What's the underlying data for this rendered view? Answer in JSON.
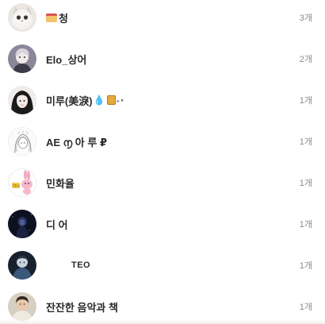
{
  "conversations": [
    {
      "name": "청",
      "count": "3개",
      "avatar_icon": "cat-avatar-icon",
      "prefix_emoji": "cake-icon"
    },
    {
      "name": "Elo_상어",
      "count": "2개",
      "avatar_icon": "anime-character-avatar-icon"
    },
    {
      "name": "미루(美淚)",
      "count": "1개",
      "avatar_icon": "dark-hair-avatar-icon",
      "suffix_emoji": [
        "droplet-icon",
        "can-icon",
        "sparkle-icon"
      ]
    },
    {
      "name": "AE ൱ 아 루 ₽",
      "count": "1개",
      "avatar_icon": "sketch-avatar-icon"
    },
    {
      "name": "민화율",
      "count": "1개",
      "avatar_icon": "bunny-avatar-icon"
    },
    {
      "name": "디 어",
      "count": "1개",
      "avatar_icon": "night-figure-avatar-icon"
    },
    {
      "name": "TEO",
      "count": "1개",
      "avatar_icon": "blue-figure-avatar-icon"
    },
    {
      "name": "잔잔한 음악과 책",
      "count": "1개",
      "avatar_icon": "person-avatar-icon"
    }
  ]
}
